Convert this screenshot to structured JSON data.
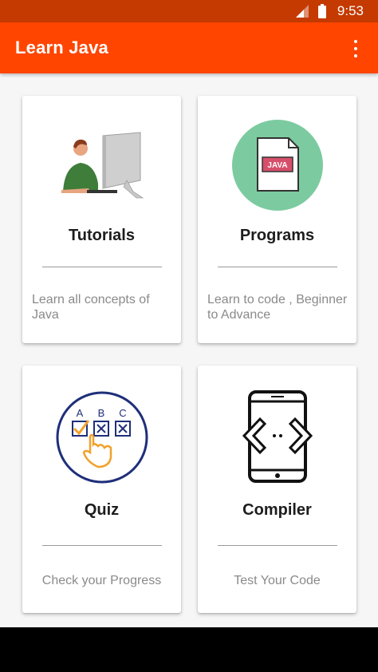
{
  "status_bar": {
    "time": "9:53",
    "signal_icon": "signal-icon",
    "battery_icon": "battery-icon"
  },
  "app_bar": {
    "title": "Learn Java",
    "menu_icon": "more-vert-icon",
    "color": "#ff4500"
  },
  "cards": [
    {
      "title": "Tutorials",
      "description": "Learn all concepts of Java",
      "icon": "person-computer-icon"
    },
    {
      "title": "Programs",
      "description": "Learn to code , Beginner to Advance",
      "icon": "java-file-icon",
      "badge": "JAVA"
    },
    {
      "title": "Quiz",
      "description": "Check your Progress",
      "icon": "quiz-abc-icon",
      "letters": [
        "A",
        "B",
        "C"
      ]
    },
    {
      "title": "Compiler",
      "description": "Test Your Code",
      "icon": "phone-code-icon"
    }
  ]
}
